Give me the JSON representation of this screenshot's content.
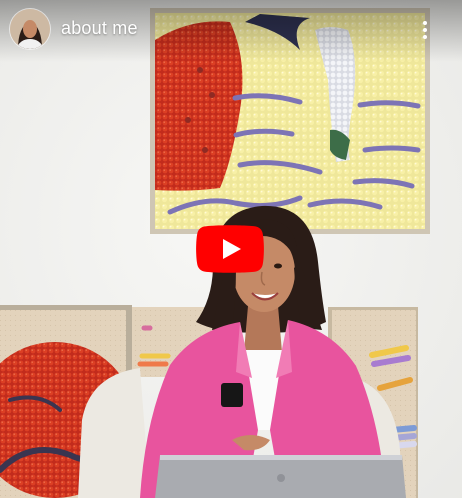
{
  "video": {
    "title": "about me",
    "channel_avatar": "channel-avatar",
    "play_icon": "play-icon",
    "more_icon": "more-vertical-icon"
  },
  "colors": {
    "play_button_red": "#ff0000",
    "blazer_pink": "#e8549e",
    "wall": "#f3f3f1"
  }
}
